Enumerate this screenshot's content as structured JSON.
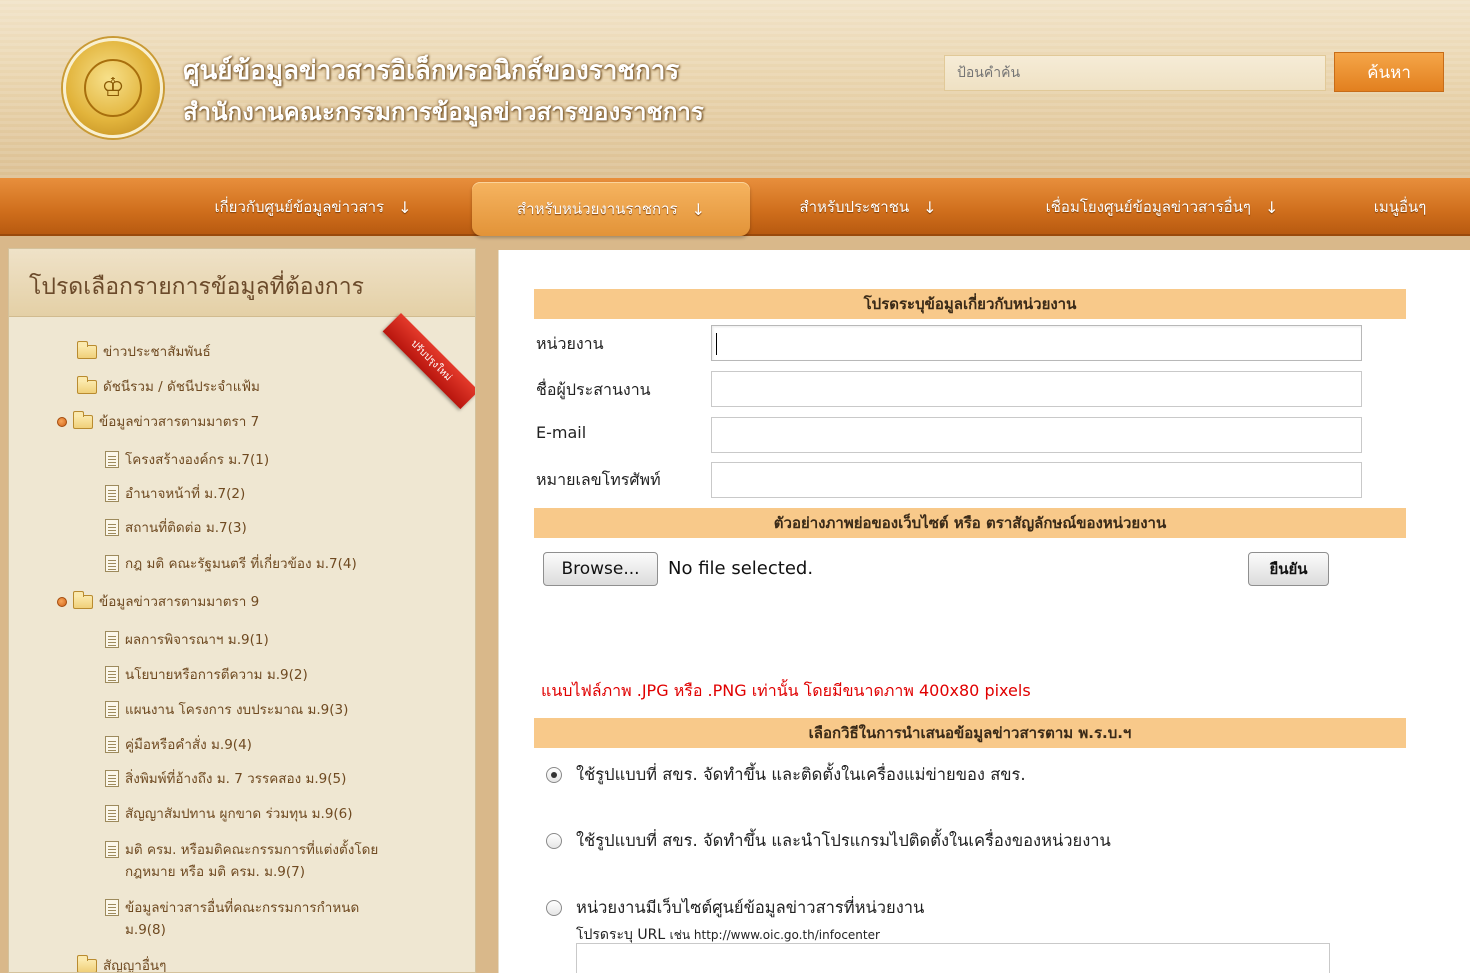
{
  "header": {
    "title": "ศูนย์ข้อมูลข่าวสารอิเล็กทรอนิกส์ของราชการ",
    "subtitle": "สำนักงานคณะกรรมการข้อมูลข่าวสารของราชการ",
    "search_placeholder": "ป้อนคำค้น",
    "search_button": "ค้นหา"
  },
  "nav": {
    "items": [
      {
        "label": "เกี่ยวกับศูนย์ข้อมูลข่าวสาร",
        "arrow": "↓"
      },
      {
        "label": "สำหรับหน่วยงานราชการ",
        "arrow": "↓",
        "active": true
      },
      {
        "label": "สำหรับประชาชน",
        "arrow": "↓"
      },
      {
        "label": "เชื่อมโยงศูนย์ข้อมูลข่าวสารอื่นๆ",
        "arrow": "↓"
      },
      {
        "label": "เมนูอื่นๆ",
        "arrow": ""
      }
    ]
  },
  "sidebar": {
    "title": "โปรดเลือกรายการข้อมูลที่ต้องการ",
    "ribbon": "ปรับปรุงใหม่",
    "items": [
      {
        "label": "ข่าวประชาสัมพันธ์",
        "icon": "folder-icon"
      },
      {
        "label": "ดัชนีรวม / ดัชนีประจำแฟ้ม",
        "icon": "folder-icon"
      },
      {
        "label": "ข้อมูลข่าวสารตามมาตรา 7",
        "icon": "folder-icon"
      },
      {
        "label": "โครงสร้างองค์กร ม.7(1)",
        "icon": "document-icon"
      },
      {
        "label": "อำนาจหน้าที่ ม.7(2)",
        "icon": "document-icon"
      },
      {
        "label": "สถานที่ติดต่อ ม.7(3)",
        "icon": "document-icon"
      },
      {
        "label": "กฎ มติ คณะรัฐมนตรี ที่เกี่ยวข้อง ม.7(4)",
        "icon": "document-icon"
      },
      {
        "label": "ข้อมูลข่าวสารตามมาตรา 9",
        "icon": "folder-icon"
      },
      {
        "label": "ผลการพิจารณาฯ ม.9(1)",
        "icon": "document-icon"
      },
      {
        "label": "นโยบายหรือการตีความ ม.9(2)",
        "icon": "document-icon"
      },
      {
        "label": "แผนงาน โครงการ งบประมาณ ม.9(3)",
        "icon": "document-icon"
      },
      {
        "label": "คู่มือหรือคำสั่ง ม.9(4)",
        "icon": "document-icon"
      },
      {
        "label": "สิ่งพิมพ์ที่อ้างถึง ม. 7 วรรคสอง ม.9(5)",
        "icon": "document-icon"
      },
      {
        "label": "สัญญาสัมปทาน ผูกขาด ร่วมทุน ม.9(6)",
        "icon": "document-icon"
      },
      {
        "label": "มติ ครม. หรือมติคณะกรรมการที่แต่งตั้งโดย",
        "label2": "กฎหมาย หรือ มติ ครม. ม.9(7)",
        "icon": "document-icon"
      },
      {
        "label": "ข้อมูลข่าวสารอื่นที่คณะกรรมการกำหนด",
        "label2": "ม.9(8)",
        "icon": "document-icon"
      },
      {
        "label": "สัญญาอื่นๆ",
        "icon": "folder-icon"
      }
    ]
  },
  "form": {
    "section1_title": "โปรดระบุข้อมูลเกี่ยวกับหน่วยงาน",
    "agency_label": "หน่วยงาน",
    "agency_value": "",
    "coordinator_label": "ชื่อผู้ประสานงาน",
    "coordinator_value": "",
    "email_label": "E-mail",
    "email_value": "",
    "phone_label": "หมายเลขโทรศัพท์",
    "phone_value": "",
    "section2_title": "ตัวอย่างภาพย่อของเว็บไซต์ หรือ ตราสัญลักษณ์ของหน่วยงาน",
    "browse_button": "Browse...",
    "file_status": "No file selected.",
    "confirm_button": "ยืนยัน",
    "image_note": "แนบไฟล์ภาพ .JPG หรือ .PNG เท่านั้น โดยมีขนาดภาพ 400x80 pixels",
    "section3_title": "เลือกวิธีในการนำเสนอข้อมูลข่าวสารตาม พ.ร.บ.ฯ",
    "option1": "ใช้รูปแบบที่ สขร. จัดทำขึ้น และติดตั้งในเครื่องแม่ข่ายของ สขร.",
    "option2": "ใช้รูปแบบที่ สขร. จัดทำขึ้น และนำโปรแกรมไปติดตั้งในเครื่องของหน่วยงาน",
    "option3": "หน่วยงานมีเว็บไซต์ศูนย์ข้อมูลข่าวสารที่หน่วยงาน",
    "url_hint_label": "โปรดระบุ URL",
    "url_hint_example": "เช่น http://www.oic.go.th/infocenter",
    "url_value": ""
  }
}
